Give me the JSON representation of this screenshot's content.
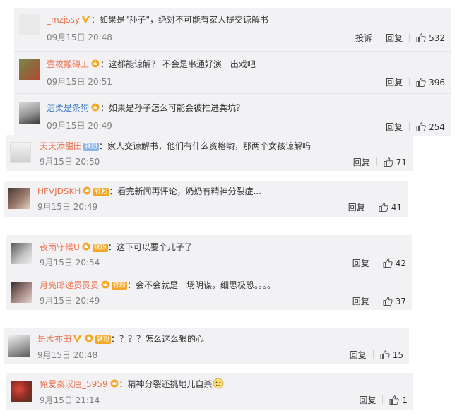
{
  "comments": [
    {
      "user": "_mzjssy",
      "content": "：如果是\"孙子\"，绝对不可能有家人提交谅解书",
      "time": "09月15日 20:48",
      "report": "投诉",
      "reply": "回复",
      "likes": "532"
    },
    {
      "user": "壹枚搬磚工",
      "content": "：这都能谅解？ 不会是串通好演一出戏吧",
      "time": "09月15日 20:51",
      "reply": "回复",
      "likes": "396"
    },
    {
      "user": "洁柔是条狗",
      "content": "：如果是孙子怎么可能会被推进粪坑？",
      "time": "09月15日 20:49",
      "reply": "回复",
      "likes": "254"
    },
    {
      "user": "天天添甜田",
      "badge": "铁粉",
      "content": "：家人交谅解书，他们有什么资格哟，那两个女孩谅解吗",
      "time": "9月15日 20:50",
      "reply": "回复",
      "likes": "71"
    },
    {
      "user": "HFVJDSKH",
      "badge": "铁粉",
      "content": "：看完新闻再评论，奶奶有精神分裂症...",
      "time": "9月15日 20:49",
      "reply": "回复",
      "likes": "41"
    },
    {
      "user": "夜雨守候U",
      "badge": "铁粉",
      "content": "：这下可以要个儿子了",
      "time": "9月15日 20:54",
      "reply": "回复",
      "likes": "42"
    },
    {
      "user": "月亮邮递员员员",
      "badge": "铁粉",
      "content": "：会不会就是一场阴谋，细思极恐。。。。",
      "time": "9月15日 20:49",
      "reply": "回复",
      "likes": "37"
    },
    {
      "user": "是孟亦田",
      "badge": "铁粉",
      "content": "：？？？怎么这么狠的心",
      "time": "9月15日 20:48",
      "reply": "回复",
      "likes": "15"
    },
    {
      "user": "俺爱秦汉唐_5959",
      "content": "：精神分裂还挑地儿自杀",
      "time": "9月15日 21:14",
      "reply": "回复",
      "likes": "1"
    }
  ],
  "colors": {
    "card_bg": "#f2f2f5",
    "username": "#eb7350",
    "text": "#333333",
    "time": "#808080",
    "vip_badge": "#f5a623",
    "iron_fan_badge": "#f5a623"
  },
  "icons": {
    "like": "thumbs-up-icon",
    "vip": "vip-crown-icon",
    "verified": "verified-v-icon",
    "emoji": "smiley-emoji-icon"
  }
}
